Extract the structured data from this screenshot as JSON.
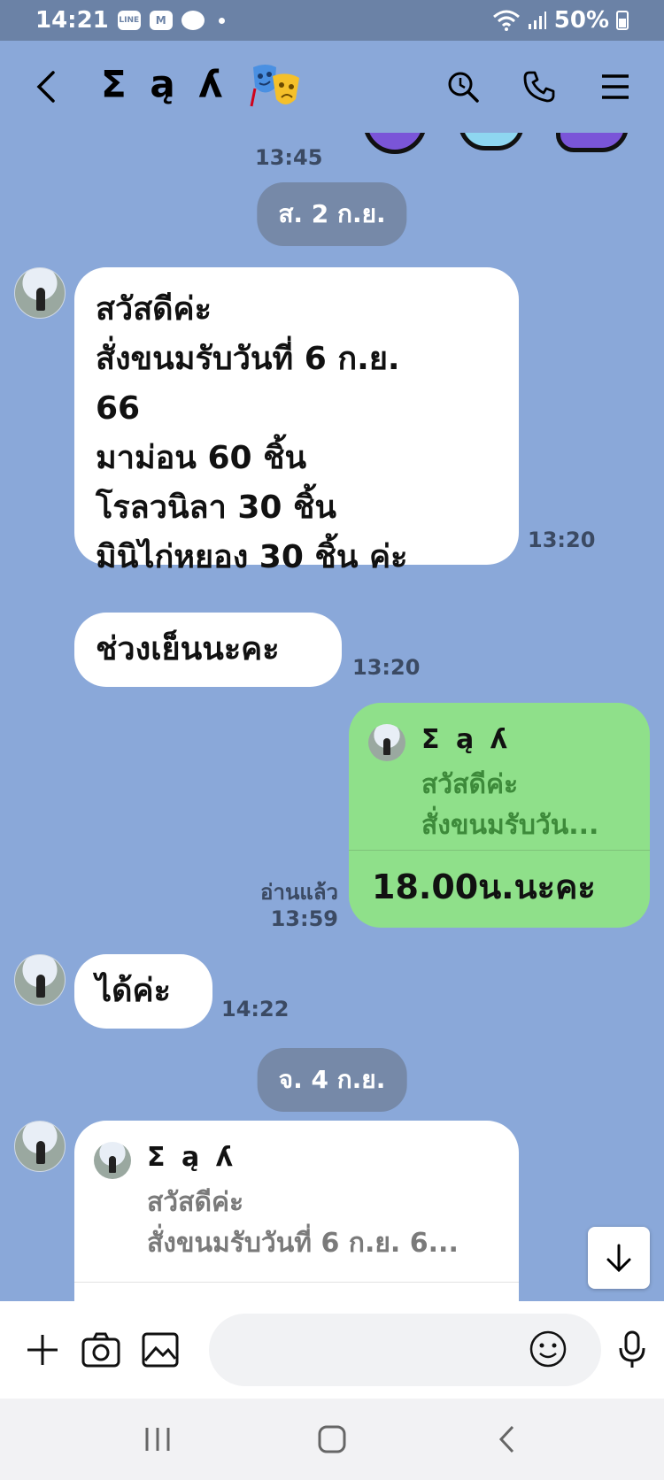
{
  "status_bar": {
    "time": "14:21",
    "app_icons": [
      "LINE",
      "M",
      "•"
    ],
    "battery": "50%"
  },
  "header": {
    "title": "Σ ą ʎ",
    "icons": [
      "back-icon",
      "search-icon",
      "phone-icon",
      "menu-icon"
    ]
  },
  "messages": {
    "prev_time": "13:45",
    "date1": "ส. 2 ก.ย.",
    "msg1": {
      "lines": [
        "สวัสดีค่ะ",
        "สั่งขนมรับวันที่ 6 ก.ย.",
        "66",
        "มาม่อน 60 ชิ้น",
        "โรลวนิลา 30 ชิ้น",
        "มินิไก่หยอง 30 ชิ้น ค่ะ"
      ],
      "time": "13:20"
    },
    "msg2": {
      "text": "ช่วงเย็นนะคะ",
      "time": "13:20"
    },
    "msg3": {
      "reply_name": "Σ ą ʎ",
      "reply_line1": "สวัสดีค่ะ",
      "reply_line2": "สั่งขนมรับวัน...",
      "text": "18.00น.นะคะ",
      "read": "อ่านแล้ว",
      "time": "13:59"
    },
    "msg4": {
      "text": "ได้ค่ะ",
      "time": "14:22"
    },
    "date2": "จ. 4 ก.ย.",
    "msg5": {
      "reply_name": "Σ ą ʎ",
      "reply_line1": "สวัสดีค่ะ",
      "reply_line2": "สั่งขนมรับวันที่ 6 ก.ย. 6..."
    }
  },
  "input": {
    "placeholder": ""
  },
  "colors": {
    "chat_bg": "#8aa8d9",
    "own_bubble": "#8fe08a",
    "other_bubble": "#ffffff",
    "date_pill": "#7689a8"
  }
}
